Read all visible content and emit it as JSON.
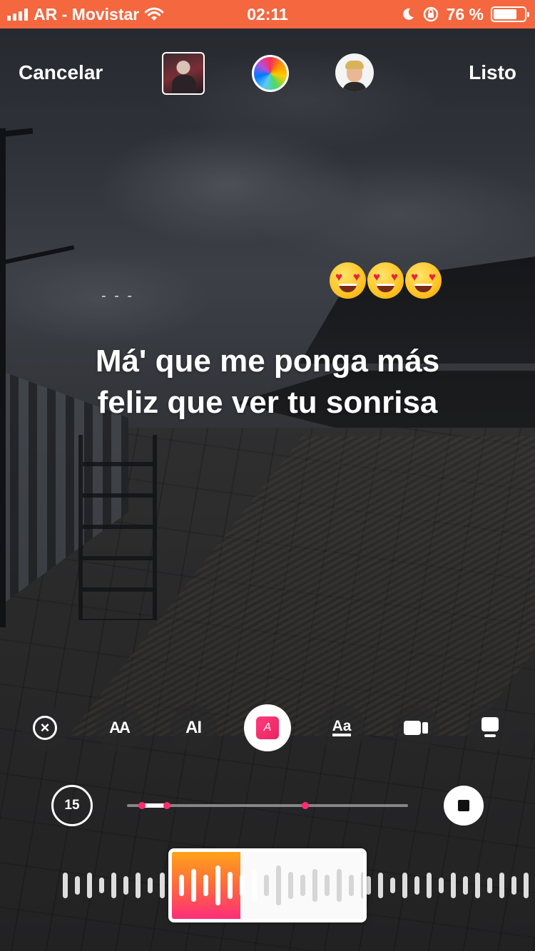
{
  "status_bar": {
    "carrier": "AR - Movistar",
    "time": "02:11",
    "battery_percent_label": "76 %",
    "battery_level": 0.76,
    "icons": [
      "signal-icon",
      "wifi-icon",
      "moon-icon",
      "orientation-lock-icon",
      "battery-icon"
    ],
    "background_color": "#f4673f"
  },
  "top_bar": {
    "cancel_label": "Cancelar",
    "done_label": "Listo",
    "icons": [
      "album-cover-thumbnail",
      "color-wheel-icon",
      "avatar"
    ]
  },
  "lyrics": {
    "emojis": [
      "😍",
      "😍",
      "😍"
    ],
    "previous_line": "- - -",
    "current_line": "Má' que me ponga más feliz que ver tu sonrisa"
  },
  "style_tools": [
    {
      "name": "remove",
      "icon": "close-circle-icon",
      "label": ""
    },
    {
      "name": "text-size",
      "icon": "text-size-icon",
      "label": "AA"
    },
    {
      "name": "text-highlight",
      "icon": "text-highlight-icon",
      "label": "AI"
    },
    {
      "name": "color-style",
      "icon": "pink-text-icon",
      "label": "A",
      "active": true
    },
    {
      "name": "text-format",
      "icon": "text-format-icon",
      "label": "Aa"
    },
    {
      "name": "video",
      "icon": "video-camera-icon",
      "label": ""
    },
    {
      "name": "sticker-card",
      "icon": "card-icon",
      "label": ""
    }
  ],
  "playback": {
    "duration_label": "15",
    "accent_color": "#ff2d6f",
    "progress_fraction": 0.14
  },
  "waveform": {
    "selection_progress_fraction": 0.36,
    "gradient_colors": [
      "#ffa31a",
      "#ff6a3c",
      "#ff2d7a"
    ]
  }
}
